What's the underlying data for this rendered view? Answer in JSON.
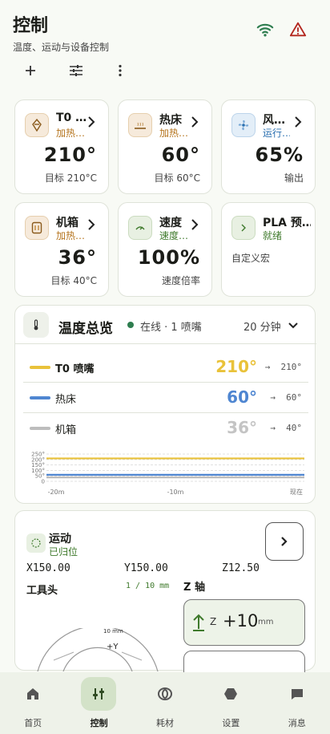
{
  "header": {
    "title": "控制",
    "subtitle": "温度、运动与设备控制",
    "icons": [
      "wifi-icon",
      "warning-icon"
    ],
    "toolbar": [
      "add-icon",
      "tune-icon",
      "more-vertical-icon"
    ]
  },
  "modules": [
    {
      "name": "T0 …",
      "status": "加热…",
      "value": "210°",
      "sub": "目标 210°C",
      "icon": "nozzle-icon"
    },
    {
      "name": "热床",
      "status": "加热…",
      "value": "60°",
      "sub": "目标 60°C",
      "icon": "bed-icon"
    },
    {
      "name": "风…",
      "status": "运行…",
      "value": "65%",
      "sub": "输出",
      "icon": "fan-icon"
    },
    {
      "name": "机箱",
      "status": "加热…",
      "value": "36°",
      "sub": "目标 40°C",
      "icon": "chamber-icon"
    },
    {
      "name": "速度",
      "status": "速度…",
      "value": "100%",
      "sub": "速度倍率",
      "icon": "speed-icon"
    },
    {
      "name": "PLA 预…",
      "status": "就绪",
      "value": "",
      "sub": "自定义宏",
      "icon": "macro-icon"
    }
  ],
  "colors": {
    "heating": "#b5741d",
    "running": "#2a6fb0",
    "ready": "#3f7a2c",
    "nozzle_line": "#e9c23a",
    "bed_line": "#4f86d1",
    "chamber_line": "#bdbdbd"
  },
  "temp_overview": {
    "title": "温度总览",
    "status": "在线 · 1 喷嘴",
    "range": "20 分钟",
    "rows": [
      {
        "name": "T0 喷嘴",
        "value": "210°",
        "arrow": "→",
        "target": "210°"
      },
      {
        "name": "热床",
        "value": "60°",
        "arrow": "→",
        "target": "60°"
      },
      {
        "name": "机箱",
        "value": "36°",
        "arrow": "→",
        "target": "40°"
      }
    ]
  },
  "chart_data": {
    "type": "line",
    "x_ticks": [
      "-20m",
      "-10m",
      "现在"
    ],
    "y_ticks": [
      "250°",
      "200°",
      "150°",
      "100°",
      "50°",
      "0"
    ],
    "ylim": [
      0,
      250
    ],
    "series": [
      {
        "name": "T0 喷嘴",
        "color": "#e9c23a",
        "values": [
          210,
          210,
          210,
          210,
          210
        ]
      },
      {
        "name": "热床",
        "color": "#4f86d1",
        "values": [
          60,
          60,
          60,
          60,
          60
        ]
      },
      {
        "name": "机箱",
        "color": "#bdbdbd",
        "values": [
          36,
          36,
          36,
          36,
          36
        ]
      }
    ]
  },
  "motion": {
    "title": "运动",
    "status": "已归位",
    "x": "X150.00",
    "y": "Y150.00",
    "z": "Z12.50",
    "toolhead_label": "工具头",
    "step": "1 / 10 mm",
    "z_label": "Z 轴",
    "z_axis": "Z",
    "z_value": "+10",
    "z_unit": "mm",
    "jog_step": "10 mm",
    "jog_y": "+Y"
  },
  "nav": [
    {
      "label": "首页",
      "icon": "home-icon",
      "active": false
    },
    {
      "label": "控制",
      "icon": "control-icon",
      "active": true
    },
    {
      "label": "耗材",
      "icon": "filament-icon",
      "active": false
    },
    {
      "label": "设置",
      "icon": "settings-icon",
      "active": false
    },
    {
      "label": "消息",
      "icon": "message-icon",
      "active": false
    }
  ]
}
